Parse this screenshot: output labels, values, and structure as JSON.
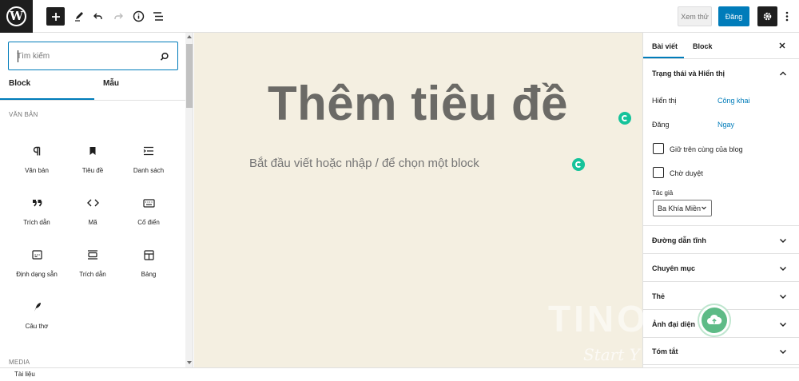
{
  "toolbar": {
    "preview_label": "Xem thử",
    "publish_label": "Đăng",
    "accent": "#007cba"
  },
  "inserter": {
    "search_placeholder": "Tìm kiếm",
    "tabs": [
      {
        "label": "Block"
      },
      {
        "label": "Mẫu"
      }
    ],
    "categories": {
      "text": "VĂN BẢN",
      "media": "MEDIA"
    },
    "blocks": [
      {
        "label": "Văn bản",
        "icon": "paragraph-icon"
      },
      {
        "label": "Tiêu đề",
        "icon": "bookmark-icon"
      },
      {
        "label": "Danh sách",
        "icon": "list-icon"
      },
      {
        "label": "Trích dẫn",
        "icon": "quote-icon"
      },
      {
        "label": "Mã",
        "icon": "code-icon"
      },
      {
        "label": "Cổ điển",
        "icon": "keyboard-icon"
      },
      {
        "label": "Định dạng sẵn",
        "icon": "preformatted-icon"
      },
      {
        "label": "Trích dẫn",
        "icon": "pullquote-icon"
      },
      {
        "label": "Bảng",
        "icon": "table-icon"
      },
      {
        "label": "Câu thơ",
        "icon": "feather-icon"
      }
    ]
  },
  "editor": {
    "title_placeholder": "Thêm tiêu đề",
    "body_placeholder": "Bắt đầu viết hoặc nhập / để chọn một block",
    "background": "#f4efe1"
  },
  "sidebar": {
    "tabs": [
      {
        "label": "Bài viết"
      },
      {
        "label": "Block"
      }
    ],
    "status_panel": {
      "title": "Trạng thái và Hiển thị",
      "visibility_label": "Hiển thị",
      "visibility_value": "Công khai",
      "publish_label": "Đăng",
      "publish_value": "Ngay",
      "sticky_label": "Giữ trên cùng của blog",
      "pending_label": "Chờ duyệt",
      "author_label": "Tác giả",
      "author_value": "Ba Khía Miền"
    },
    "panels": [
      {
        "title": "Đường dẫn tĩnh"
      },
      {
        "title": "Chuyên mục"
      },
      {
        "title": "Thẻ"
      },
      {
        "title": "Ảnh đại diện"
      },
      {
        "title": "Tóm tắt"
      }
    ]
  },
  "watermark": {
    "text": "TINO",
    "tagline": "Start Y"
  },
  "footer": {
    "breadcrumb": "Tài liệu"
  }
}
